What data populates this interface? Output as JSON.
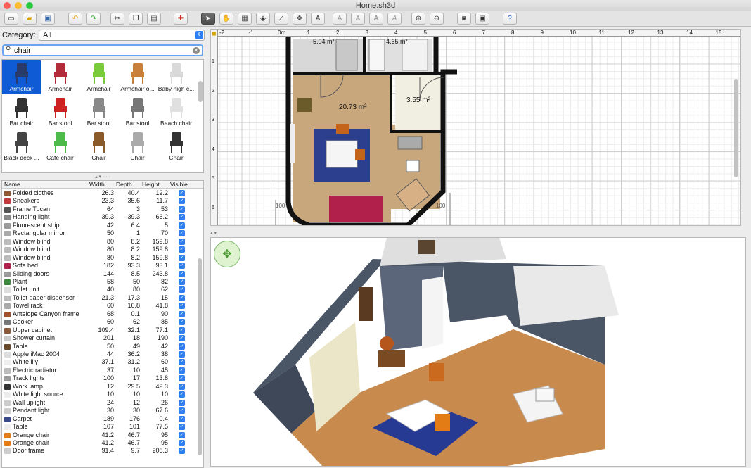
{
  "window": {
    "title": "Home.sh3d"
  },
  "colors": {
    "accent": "#2f80f5",
    "selection": "#0f5bd6"
  },
  "category": {
    "label": "Category:",
    "value": "All"
  },
  "search": {
    "value": "chair"
  },
  "catalog": [
    {
      "label": "Armchair",
      "selected": true
    },
    {
      "label": "Armchair"
    },
    {
      "label": "Armchair"
    },
    {
      "label": "Armchair o..."
    },
    {
      "label": "Baby high c..."
    },
    {
      "label": "Bar chair"
    },
    {
      "label": "Bar stool"
    },
    {
      "label": "Bar stool"
    },
    {
      "label": "Bar stool"
    },
    {
      "label": "Beach chair"
    },
    {
      "label": "Black deck ..."
    },
    {
      "label": "Cafe chair"
    },
    {
      "label": "Chair"
    },
    {
      "label": "Chair"
    },
    {
      "label": "Chair"
    }
  ],
  "table": {
    "headers": {
      "name": "Name",
      "width": "Width",
      "depth": "Depth",
      "height": "Height",
      "visible": "Visible"
    },
    "rows": [
      {
        "name": "Folded clothes",
        "width": "26.3",
        "depth": "40.4",
        "height": "12.2"
      },
      {
        "name": "Sneakers",
        "width": "23.3",
        "depth": "35.6",
        "height": "11.7"
      },
      {
        "name": "Frame Tucan",
        "width": "64",
        "depth": "3",
        "height": "53"
      },
      {
        "name": "Hanging light",
        "width": "39.3",
        "depth": "39.3",
        "height": "66.2"
      },
      {
        "name": "Fluorescent strip",
        "width": "42",
        "depth": "6.4",
        "height": "5"
      },
      {
        "name": "Rectangular mirror",
        "width": "50",
        "depth": "1",
        "height": "70"
      },
      {
        "name": "Window blind",
        "width": "80",
        "depth": "8.2",
        "height": "159.8"
      },
      {
        "name": "Window blind",
        "width": "80",
        "depth": "8.2",
        "height": "159.8"
      },
      {
        "name": "Window blind",
        "width": "80",
        "depth": "8.2",
        "height": "159.8"
      },
      {
        "name": "Sofa bed",
        "width": "182",
        "depth": "93.3",
        "height": "93.1"
      },
      {
        "name": "Sliding doors",
        "width": "144",
        "depth": "8.5",
        "height": "243.8"
      },
      {
        "name": "Plant",
        "width": "58",
        "depth": "50",
        "height": "82"
      },
      {
        "name": "Toilet unit",
        "width": "40",
        "depth": "80",
        "height": "62"
      },
      {
        "name": "Toilet paper dispenser",
        "width": "21.3",
        "depth": "17.3",
        "height": "15"
      },
      {
        "name": "Towel rack",
        "width": "60",
        "depth": "16.8",
        "height": "41.8"
      },
      {
        "name": "Antelope Canyon frame",
        "width": "68",
        "depth": "0.1",
        "height": "90"
      },
      {
        "name": "Cooker",
        "width": "60",
        "depth": "62",
        "height": "85"
      },
      {
        "name": "Upper cabinet",
        "width": "109.4",
        "depth": "32.1",
        "height": "77.1"
      },
      {
        "name": "Shower curtain",
        "width": "201",
        "depth": "18",
        "height": "190"
      },
      {
        "name": "Table",
        "width": "50",
        "depth": "49",
        "height": "42"
      },
      {
        "name": "Apple iMac 2004",
        "width": "44",
        "depth": "36.2",
        "height": "38"
      },
      {
        "name": "White lily",
        "width": "37.1",
        "depth": "31.2",
        "height": "60"
      },
      {
        "name": "Electric radiator",
        "width": "37",
        "depth": "10",
        "height": "45"
      },
      {
        "name": "Track lights",
        "width": "100",
        "depth": "17",
        "height": "13.8"
      },
      {
        "name": "Work lamp",
        "width": "12",
        "depth": "29.5",
        "height": "49.3"
      },
      {
        "name": "White light source",
        "width": "10",
        "depth": "10",
        "height": "10"
      },
      {
        "name": "Wall uplight",
        "width": "24",
        "depth": "12",
        "height": "26"
      },
      {
        "name": "Pendant light",
        "width": "30",
        "depth": "30",
        "height": "67.6"
      },
      {
        "name": "Carpet",
        "width": "189",
        "depth": "176",
        "height": "0.4"
      },
      {
        "name": "Table",
        "width": "107",
        "depth": "101",
        "height": "77.5"
      },
      {
        "name": "Orange chair",
        "width": "41.2",
        "depth": "46.7",
        "height": "95"
      },
      {
        "name": "Orange chair",
        "width": "41.2",
        "depth": "46.7",
        "height": "95"
      },
      {
        "name": "Door frame",
        "width": "91.4",
        "depth": "9.7",
        "height": "208.3"
      }
    ]
  },
  "plan": {
    "ruler_x": [
      "-2",
      "-1",
      "0m",
      "1",
      "2",
      "3",
      "4",
      "5",
      "6",
      "7",
      "8",
      "9",
      "10",
      "11",
      "12",
      "13",
      "14",
      "15"
    ],
    "ruler_y": [
      "1",
      "2",
      "3",
      "4",
      "5",
      "6"
    ],
    "room_area_main": "20.73 m²",
    "room_area_hall": "3.55 m²",
    "room_area_top_left": "5.04 m²",
    "room_area_top_right": "4.65 m²",
    "dim_left": "100",
    "dim_right": "100"
  }
}
